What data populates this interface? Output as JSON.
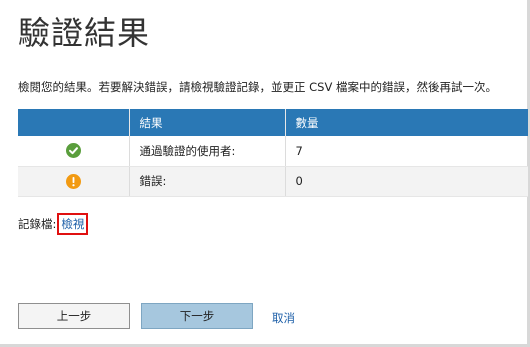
{
  "page": {
    "title": "驗證結果",
    "instructions": "檢閱您的結果。若要解決錯誤，請檢視驗證記錄，並更正 CSV 檔案中的錯誤，然後再試一次。"
  },
  "table": {
    "headers": [
      "",
      "結果",
      "數量"
    ],
    "rows": [
      {
        "icon": "check-circle-icon",
        "icon_color": "#5a9e3c",
        "label": "通過驗證的使用者:",
        "count": "7"
      },
      {
        "icon": "warning-circle-icon",
        "icon_color": "#f29a12",
        "label": "錯誤:",
        "count": "0"
      }
    ],
    "header_color": "#2a78b5"
  },
  "log": {
    "label": "記錄檔:",
    "link_text": "檢視"
  },
  "buttons": {
    "back": "上一步",
    "next": "下一步",
    "cancel": "取消"
  }
}
